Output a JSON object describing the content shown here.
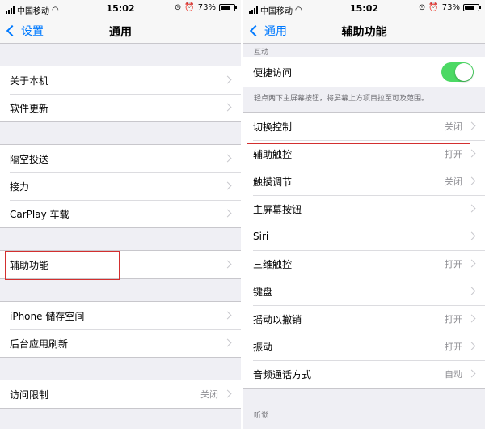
{
  "status_bar": {
    "carrier": "中国移动",
    "time": "15:02",
    "battery": "73%"
  },
  "left": {
    "back_label": "设置",
    "title": "通用",
    "groups": [
      [
        {
          "label": "关于本机"
        },
        {
          "label": "软件更新"
        }
      ],
      [
        {
          "label": "隔空投送"
        },
        {
          "label": "接力"
        },
        {
          "label": "CarPlay 车载"
        }
      ],
      [
        {
          "label": "辅助功能"
        }
      ],
      [
        {
          "label": "iPhone 储存空间"
        },
        {
          "label": "后台应用刷新"
        }
      ],
      [
        {
          "label": "访问限制",
          "value": "关闭"
        }
      ]
    ]
  },
  "right": {
    "back_label": "通用",
    "title": "辅助功能",
    "section_interaction": "互动",
    "reachability_label": "便捷访问",
    "reachability_on": true,
    "reachability_note": "轻点两下主屏幕按钮，将屏幕上方项目拉至可及范围。",
    "items": [
      {
        "label": "切换控制",
        "value": "关闭"
      },
      {
        "label": "辅助触控",
        "value": "打开"
      },
      {
        "label": "触摸调节",
        "value": "关闭"
      },
      {
        "label": "主屏幕按钮",
        "value": ""
      },
      {
        "label": "Siri",
        "value": ""
      },
      {
        "label": "三维触控",
        "value": "打开"
      },
      {
        "label": "键盘",
        "value": ""
      },
      {
        "label": "摇动以撤销",
        "value": "打开"
      },
      {
        "label": "振动",
        "value": "打开"
      },
      {
        "label": "音频通话方式",
        "value": "自动"
      }
    ],
    "section_hearing": "听觉"
  },
  "colors": {
    "accent": "#007aff",
    "toggle_on": "#4cd964",
    "highlight": "#d32f2f",
    "background": "#efeff4"
  }
}
